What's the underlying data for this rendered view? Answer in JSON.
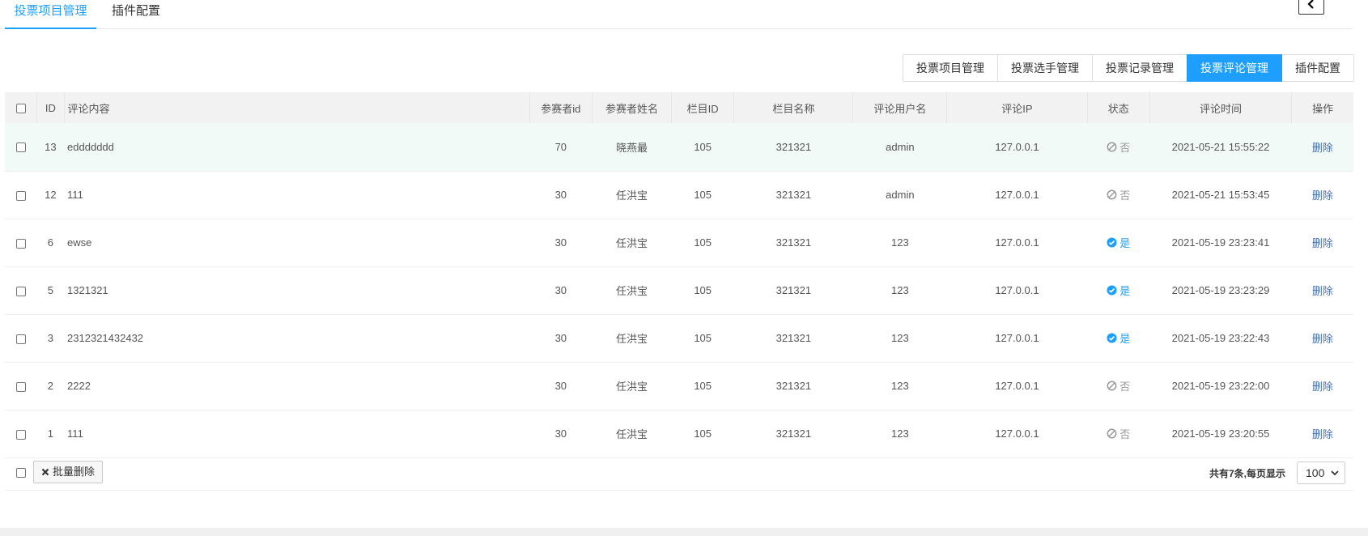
{
  "top_tabs": [
    {
      "label": "投票项目管理",
      "active": true
    },
    {
      "label": "插件配置",
      "active": false
    }
  ],
  "button_group": [
    {
      "label": "投票项目管理",
      "active": false
    },
    {
      "label": "投票选手管理",
      "active": false
    },
    {
      "label": "投票记录管理",
      "active": false
    },
    {
      "label": "投票评论管理",
      "active": true
    },
    {
      "label": "插件配置",
      "active": false
    }
  ],
  "table": {
    "columns": [
      "ID",
      "评论内容",
      "参赛者id",
      "参赛者姓名",
      "栏目ID",
      "栏目名称",
      "评论用户名",
      "评论IP",
      "状态",
      "评论时间",
      "操作"
    ],
    "rows": [
      {
        "id": "13",
        "content": "eddddddd",
        "pid": "70",
        "pname": "晓燕最",
        "cid": "105",
        "cname": "321321",
        "user": "admin",
        "ip": "127.0.0.1",
        "status": "否",
        "status_on": false,
        "time": "2021-05-21 15:55:22",
        "action": "删除"
      },
      {
        "id": "12",
        "content": "111",
        "pid": "30",
        "pname": "任洪宝",
        "cid": "105",
        "cname": "321321",
        "user": "admin",
        "ip": "127.0.0.1",
        "status": "否",
        "status_on": false,
        "time": "2021-05-21 15:53:45",
        "action": "删除"
      },
      {
        "id": "6",
        "content": "ewse",
        "pid": "30",
        "pname": "任洪宝",
        "cid": "105",
        "cname": "321321",
        "user": "123",
        "ip": "127.0.0.1",
        "status": "是",
        "status_on": true,
        "time": "2021-05-19 23:23:41",
        "action": "删除"
      },
      {
        "id": "5",
        "content": "1321321",
        "pid": "30",
        "pname": "任洪宝",
        "cid": "105",
        "cname": "321321",
        "user": "123",
        "ip": "127.0.0.1",
        "status": "是",
        "status_on": true,
        "time": "2021-05-19 23:23:29",
        "action": "删除"
      },
      {
        "id": "3",
        "content": "2312321432432",
        "pid": "30",
        "pname": "任洪宝",
        "cid": "105",
        "cname": "321321",
        "user": "123",
        "ip": "127.0.0.1",
        "status": "是",
        "status_on": true,
        "time": "2021-05-19 23:22:43",
        "action": "删除"
      },
      {
        "id": "2",
        "content": "2222",
        "pid": "30",
        "pname": "任洪宝",
        "cid": "105",
        "cname": "321321",
        "user": "123",
        "ip": "127.0.0.1",
        "status": "否",
        "status_on": false,
        "time": "2021-05-19 23:22:00",
        "action": "删除"
      },
      {
        "id": "1",
        "content": "111",
        "pid": "30",
        "pname": "任洪宝",
        "cid": "105",
        "cname": "321321",
        "user": "123",
        "ip": "127.0.0.1",
        "status": "否",
        "status_on": false,
        "time": "2021-05-19 23:20:55",
        "action": "删除"
      }
    ]
  },
  "footer": {
    "batch_delete_label": "批量删除",
    "total_text": "共有7条,每页显示",
    "page_size": "100"
  },
  "colors": {
    "accent": "#1E9FFF",
    "link": "#4a6fb5",
    "row_hover": "#f2faf7"
  }
}
